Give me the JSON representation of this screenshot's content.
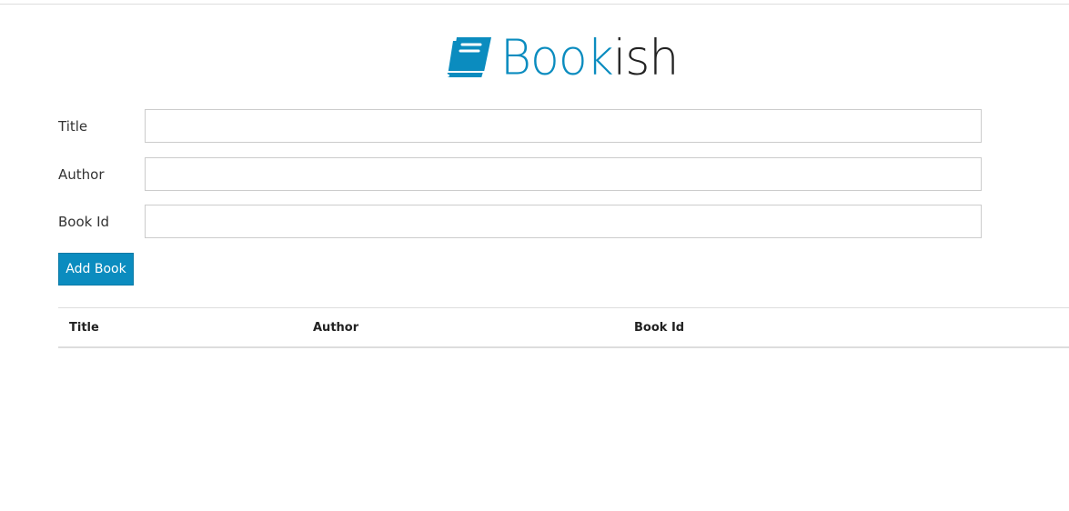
{
  "brand": {
    "name_accent": "Book",
    "name_rest": "ish",
    "icon": "book-icon",
    "accent_color": "#0b8cbf"
  },
  "form": {
    "title_label": "Title",
    "title_value": "",
    "author_label": "Author",
    "author_value": "",
    "bookid_label": "Book Id",
    "bookid_value": "",
    "submit_label": "Add Book"
  },
  "table": {
    "headers": [
      "Title",
      "Author",
      "Book Id"
    ],
    "rows": []
  }
}
